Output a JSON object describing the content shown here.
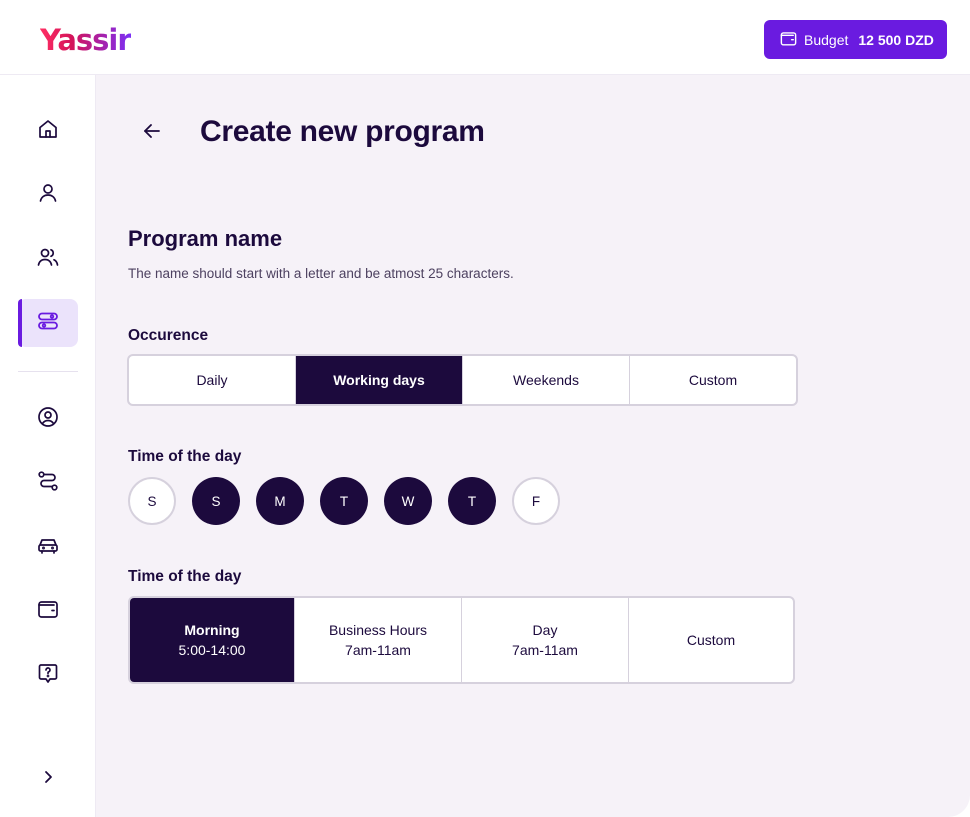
{
  "brand": {
    "logo": "Yassir"
  },
  "header": {
    "budget_label": "Budget",
    "budget_amount": "12 500 DZD"
  },
  "sidebar": {
    "items": [
      {
        "icon": "home-icon"
      },
      {
        "icon": "user-icon"
      },
      {
        "icon": "users-icon"
      },
      {
        "icon": "programs-icon",
        "active": true
      },
      {
        "icon": "profile-icon"
      },
      {
        "icon": "route-icon"
      },
      {
        "icon": "car-icon"
      },
      {
        "icon": "wallet-icon"
      },
      {
        "icon": "help-icon"
      },
      {
        "icon": "chevron-right-icon"
      }
    ],
    "accent": "#6a1be0"
  },
  "page": {
    "title": "Create new program"
  },
  "program": {
    "section_title": "Program name",
    "hint": "The name should start with a letter and be atmost 25 characters."
  },
  "occurrence": {
    "label": "Occurence",
    "options": [
      {
        "label": "Daily",
        "selected": false
      },
      {
        "label": "Working days",
        "selected": true
      },
      {
        "label": "Weekends",
        "selected": false
      },
      {
        "label": "Custom",
        "selected": false
      }
    ]
  },
  "days": {
    "label": "Time of the day",
    "items": [
      {
        "label": "S",
        "selected": false
      },
      {
        "label": "S",
        "selected": true
      },
      {
        "label": "M",
        "selected": true
      },
      {
        "label": "T",
        "selected": true
      },
      {
        "label": "W",
        "selected": true
      },
      {
        "label": "T",
        "selected": true
      },
      {
        "label": "F",
        "selected": false
      }
    ]
  },
  "time_of_day": {
    "label": "Time of the day",
    "options": [
      {
        "label": "Morning",
        "sub": "5:00-14:00",
        "selected": true
      },
      {
        "label": "Business Hours",
        "sub": "7am-11am",
        "selected": false
      },
      {
        "label": "Day",
        "sub": "7am-11am",
        "selected": false
      },
      {
        "label": "Custom",
        "sub": "",
        "selected": false
      }
    ]
  },
  "colors": {
    "primary": "#6a1be0",
    "dark": "#1c0a3d",
    "background": "#f6f2f8"
  }
}
